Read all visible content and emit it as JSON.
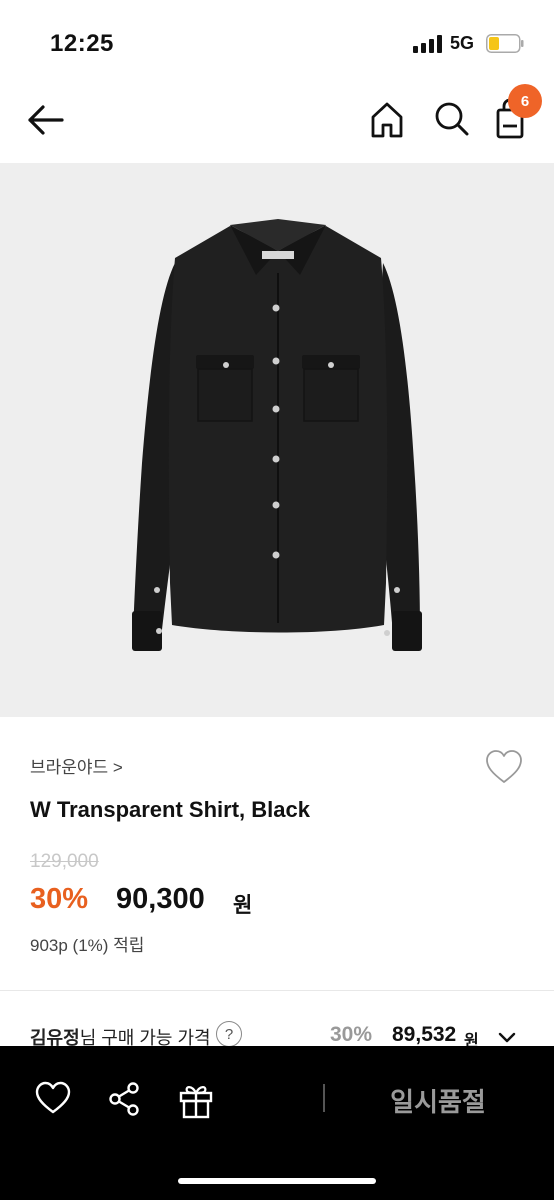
{
  "status_bar": {
    "time": "12:25",
    "network": "5G"
  },
  "nav": {
    "cart_count": "6"
  },
  "product": {
    "brand": "브라운야드 >",
    "name": "W Transparent Shirt, Black",
    "original_price": "129,000",
    "discount_rate": "30%",
    "sale_price": "90,300",
    "currency": "원",
    "points": "903p (1%) 적립"
  },
  "member_price": {
    "name": "김유정",
    "label": "님 구매 가능 가격",
    "help": "?",
    "rate": "30%",
    "price": "89,532",
    "currency": "원"
  },
  "bottom_bar": {
    "soldout_label": "일시품절"
  },
  "colors": {
    "accent": "#e8601f",
    "badge": "#ef6428",
    "bottom_bar": "#000000"
  },
  "icons": [
    "back-arrow-icon",
    "home-icon",
    "search-icon",
    "shopping-bag-icon",
    "heart-icon",
    "share-icon",
    "gift-icon",
    "chevron-down-icon"
  ]
}
